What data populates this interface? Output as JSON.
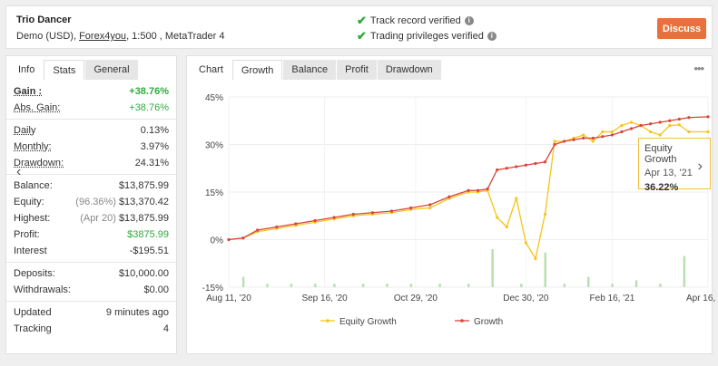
{
  "header": {
    "account_name": "Trio Dancer",
    "account_sub_prefix": "Demo (USD),",
    "broker": "Forex4you",
    "account_sub_suffix": ", 1:500 , MetaTrader 4",
    "verify_track": "Track record verified",
    "verify_trading": "Trading privileges verified",
    "discuss_label": "Discuss"
  },
  "left_tabs": [
    "Info",
    "Stats",
    "General"
  ],
  "stats": {
    "gain": {
      "label": "Gain :",
      "value": "+38.76%"
    },
    "abs_gain": {
      "label": "Abs. Gain:",
      "value": "+38.76%"
    },
    "daily": {
      "label": "Daily",
      "value": "0.13%"
    },
    "monthly": {
      "label": "Monthly:",
      "value": "3.97%"
    },
    "drawdown": {
      "label": "Drawdown:",
      "value": "24.31%"
    },
    "balance": {
      "label": "Balance:",
      "value": "$13,875.99"
    },
    "equity": {
      "label": "Equity:",
      "muted": "(96.36%)",
      "value": "$13,370.42"
    },
    "highest": {
      "label": "Highest:",
      "muted": "(Apr 20)",
      "value": "$13,875.99"
    },
    "profit": {
      "label": "Profit:",
      "value": "$3875.99"
    },
    "interest": {
      "label": "Interest",
      "value": "-$195.51"
    },
    "deposits": {
      "label": "Deposits:",
      "value": "$10,000.00"
    },
    "withdrawals": {
      "label": "Withdrawals:",
      "value": "$0.00"
    },
    "updated": {
      "label": "Updated",
      "value": "9 minutes ago"
    },
    "tracking": {
      "label": "Tracking",
      "value": "4"
    }
  },
  "right_tabs": [
    "Chart",
    "Growth",
    "Balance",
    "Profit",
    "Drawdown"
  ],
  "tooltip": {
    "title": "Equity Growth",
    "date": "Apr 13, '21",
    "value": "36.22%"
  },
  "chart_data": {
    "type": "line",
    "title": "",
    "xlabel": "",
    "ylabel": "",
    "y_ticks": [
      "45%",
      "30%",
      "15%",
      "0%",
      "-15%"
    ],
    "ylim": [
      -15,
      45
    ],
    "x_ticks": [
      "Aug 11, '20",
      "Sep 16, '20",
      "Oct 29, '20",
      "Dec 30, '20",
      "Feb 16, '21",
      "Apr 16, '21"
    ],
    "legend": "bottom",
    "series": [
      {
        "name": "Equity Growth",
        "color": "#f5c518",
        "x": [
          0,
          3,
          6,
          10,
          14,
          18,
          22,
          26,
          30,
          34,
          38,
          42,
          46,
          50,
          52,
          54,
          56,
          58,
          60,
          62,
          64,
          66,
          68,
          70,
          72,
          74,
          76,
          78,
          80,
          82,
          84,
          86,
          88,
          90,
          92,
          94,
          96,
          100
        ],
        "values": [
          0,
          0.5,
          2.5,
          3.5,
          4.5,
          5.5,
          6.5,
          7.5,
          8,
          8.5,
          9.5,
          10,
          13,
          15,
          15,
          15.5,
          7,
          4,
          13,
          -1,
          -6,
          8,
          31,
          31,
          32,
          33,
          31,
          34,
          34,
          36,
          37,
          36,
          34,
          33,
          36,
          36.22,
          34,
          34
        ]
      },
      {
        "name": "Growth",
        "color": "#d9443a",
        "x": [
          0,
          3,
          6,
          10,
          14,
          18,
          22,
          26,
          30,
          34,
          38,
          42,
          46,
          50,
          52,
          54,
          56,
          58,
          60,
          62,
          64,
          66,
          68,
          70,
          72,
          74,
          76,
          78,
          80,
          82,
          84,
          86,
          88,
          90,
          92,
          94,
          96,
          100
        ],
        "values": [
          0,
          0.5,
          3,
          4,
          5,
          6,
          7,
          8,
          8.5,
          9,
          10,
          11,
          13.5,
          15.5,
          15.5,
          16,
          22,
          22.5,
          23,
          23.5,
          24,
          24.5,
          30,
          31,
          31.5,
          32,
          32,
          32.5,
          33,
          34,
          35,
          36,
          36.5,
          37,
          37.5,
          38,
          38.5,
          38.76
        ]
      }
    ],
    "volume_bars": {
      "x": [
        3,
        8,
        13,
        18,
        22,
        28,
        33,
        38,
        44,
        50,
        55,
        61,
        66,
        70,
        75,
        80,
        85,
        90,
        95
      ],
      "values": [
        3,
        1,
        1,
        1,
        1,
        1,
        1,
        1,
        1,
        1,
        11,
        1,
        10,
        1,
        3,
        1,
        2,
        1,
        9
      ]
    }
  }
}
